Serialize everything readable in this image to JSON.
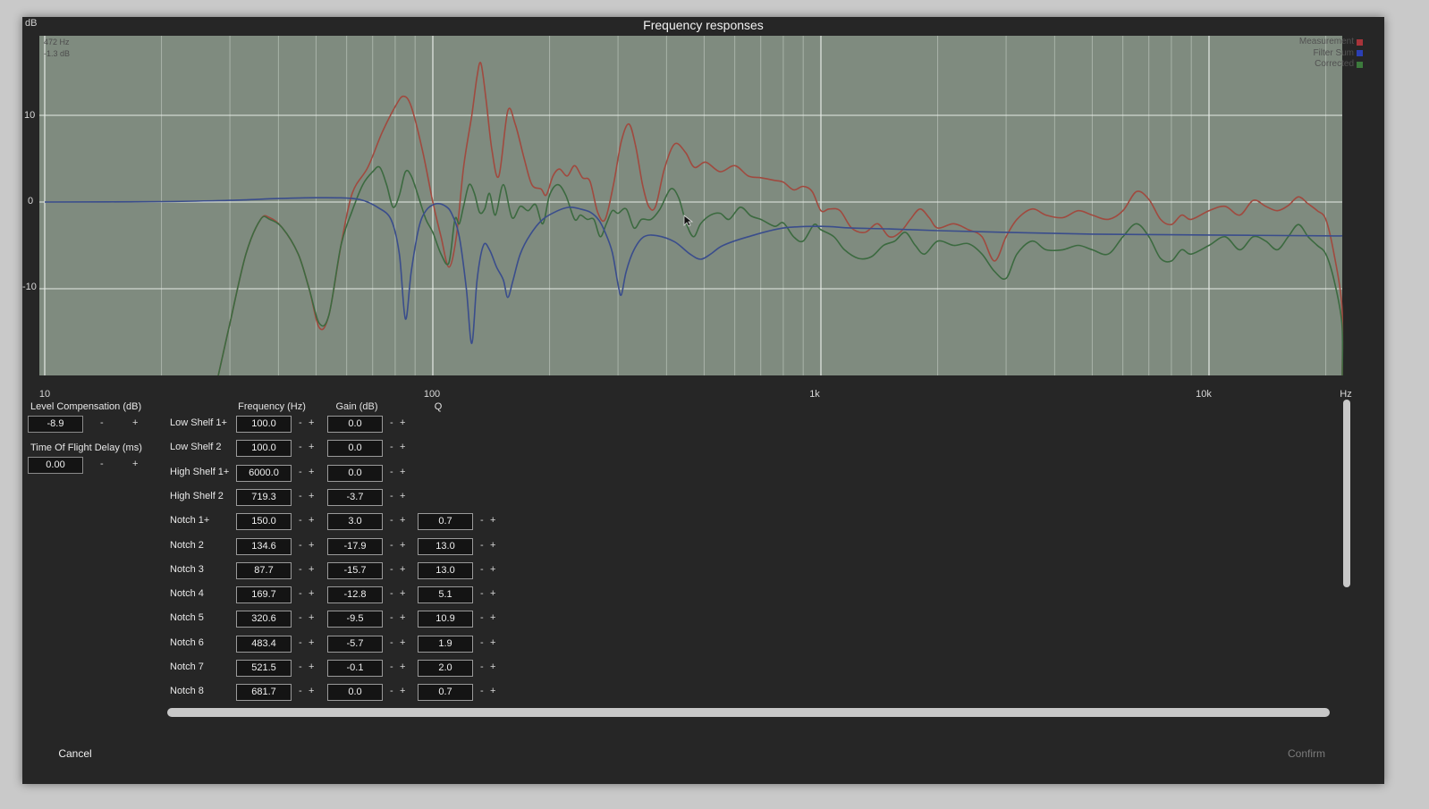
{
  "window": {
    "title": "Frequency responses"
  },
  "chart_data": {
    "type": "line",
    "ylabel": "dB",
    "xlabel": "Hz",
    "xscale": "log",
    "xlim": [
      10,
      20000
    ],
    "ylim": [
      -20,
      20
    ],
    "yticks": [
      10,
      0,
      -10
    ],
    "ytick_labels": [
      "10",
      "0",
      "-10"
    ],
    "xticks": [
      10,
      100,
      1000,
      10000
    ],
    "xtick_labels": [
      "10",
      "100",
      "1k",
      "10k"
    ],
    "grid": true,
    "legend_position": "top-right",
    "cursor_readout": {
      "freq": "472 Hz",
      "level": "-1.3 dB"
    },
    "series": [
      {
        "name": "Measurement",
        "color": "#a04a3f",
        "points": [
          [
            28,
            -20
          ],
          [
            30,
            -14
          ],
          [
            33,
            -6
          ],
          [
            36,
            -2
          ],
          [
            38,
            -1.8
          ],
          [
            41,
            -3
          ],
          [
            45,
            -6
          ],
          [
            48,
            -10
          ],
          [
            51,
            -14.5
          ],
          [
            54,
            -13
          ],
          [
            58,
            -5
          ],
          [
            62,
            1
          ],
          [
            68,
            4
          ],
          [
            74,
            8
          ],
          [
            80,
            11
          ],
          [
            84,
            12.2
          ],
          [
            88,
            11
          ],
          [
            94,
            6
          ],
          [
            100,
            0
          ],
          [
            105,
            -4
          ],
          [
            110,
            -7.5
          ],
          [
            115,
            -4
          ],
          [
            120,
            4
          ],
          [
            126,
            10
          ],
          [
            130,
            14.5
          ],
          [
            133,
            16
          ],
          [
            137,
            12
          ],
          [
            142,
            6
          ],
          [
            148,
            3
          ],
          [
            156,
            10.5
          ],
          [
            163,
            9
          ],
          [
            172,
            5
          ],
          [
            180,
            2
          ],
          [
            190,
            1.5
          ],
          [
            196,
            0.8
          ],
          [
            204,
            3
          ],
          [
            212,
            3.8
          ],
          [
            222,
            3
          ],
          [
            232,
            4.2
          ],
          [
            243,
            2.8
          ],
          [
            254,
            2.4
          ],
          [
            266,
            -1.2
          ],
          [
            278,
            -2
          ],
          [
            292,
            2
          ],
          [
            306,
            7
          ],
          [
            320,
            9
          ],
          [
            333,
            6.5
          ],
          [
            347,
            2
          ],
          [
            360,
            -0.5
          ],
          [
            375,
            -0.5
          ],
          [
            395,
            3.8
          ],
          [
            420,
            6.7
          ],
          [
            448,
            5.7
          ],
          [
            472,
            4
          ],
          [
            505,
            4.6
          ],
          [
            550,
            3.5
          ],
          [
            600,
            4.2
          ],
          [
            650,
            3
          ],
          [
            700,
            2.8
          ],
          [
            760,
            2.5
          ],
          [
            800,
            2.3
          ],
          [
            850,
            1.4
          ],
          [
            900,
            1.8
          ],
          [
            950,
            1.2
          ],
          [
            1000,
            -1
          ],
          [
            1050,
            -0.8
          ],
          [
            1120,
            -1
          ],
          [
            1200,
            -3
          ],
          [
            1300,
            -3.5
          ],
          [
            1400,
            -2.5
          ],
          [
            1500,
            -4
          ],
          [
            1600,
            -3.5
          ],
          [
            1700,
            -2
          ],
          [
            1800,
            -0.8
          ],
          [
            1900,
            -1.8
          ],
          [
            2000,
            -3
          ],
          [
            2200,
            -2.5
          ],
          [
            2400,
            -3.2
          ],
          [
            2600,
            -4
          ],
          [
            2800,
            -6.8
          ],
          [
            3000,
            -4
          ],
          [
            3200,
            -2
          ],
          [
            3500,
            -0.8
          ],
          [
            3800,
            -1.5
          ],
          [
            4200,
            -1.8
          ],
          [
            4600,
            -1
          ],
          [
            5000,
            -1.5
          ],
          [
            5500,
            -2
          ],
          [
            6000,
            -1
          ],
          [
            6500,
            1.2
          ],
          [
            7000,
            0.3
          ],
          [
            7500,
            -2
          ],
          [
            8000,
            -2.6
          ],
          [
            8500,
            -1.5
          ],
          [
            9000,
            -2
          ],
          [
            10000,
            -1
          ],
          [
            11000,
            -0.5
          ],
          [
            12000,
            -1.5
          ],
          [
            13000,
            0.2
          ],
          [
            14000,
            -0.5
          ],
          [
            15000,
            -1
          ],
          [
            16000,
            -0.4
          ],
          [
            17000,
            0.6
          ],
          [
            18000,
            -0.2
          ],
          [
            19000,
            -1
          ],
          [
            20000,
            -2
          ],
          [
            21000,
            -6
          ],
          [
            22000,
            -12
          ],
          [
            23000,
            -20
          ]
        ]
      },
      {
        "name": "Filter Sum",
        "color": "#3a4d8c",
        "points": [
          [
            10,
            0
          ],
          [
            20,
            0.05
          ],
          [
            30,
            0.2
          ],
          [
            40,
            0.4
          ],
          [
            50,
            0.5
          ],
          [
            60,
            0.45
          ],
          [
            66,
            0.2
          ],
          [
            72,
            -0.6
          ],
          [
            78,
            -2
          ],
          [
            82,
            -6
          ],
          [
            85,
            -13.5
          ],
          [
            88,
            -8
          ],
          [
            92,
            -3
          ],
          [
            96,
            -1
          ],
          [
            102,
            -0.2
          ],
          [
            108,
            -0.5
          ],
          [
            112,
            -1.4
          ],
          [
            117,
            -4
          ],
          [
            122,
            -10
          ],
          [
            126,
            -16.3
          ],
          [
            130,
            -9
          ],
          [
            135,
            -5
          ],
          [
            140,
            -5.5
          ],
          [
            146,
            -7.5
          ],
          [
            152,
            -9
          ],
          [
            156,
            -11
          ],
          [
            161,
            -9
          ],
          [
            168,
            -6
          ],
          [
            178,
            -3.8
          ],
          [
            192,
            -2
          ],
          [
            210,
            -1
          ],
          [
            225,
            -0.6
          ],
          [
            240,
            -0.8
          ],
          [
            255,
            -1.2
          ],
          [
            268,
            -2.1
          ],
          [
            278,
            -3.5
          ],
          [
            290,
            -5.8
          ],
          [
            300,
            -9.5
          ],
          [
            306,
            -10.7
          ],
          [
            315,
            -8
          ],
          [
            330,
            -5.5
          ],
          [
            350,
            -4
          ],
          [
            380,
            -3.9
          ],
          [
            420,
            -4.6
          ],
          [
            460,
            -6
          ],
          [
            490,
            -6.6
          ],
          [
            520,
            -6
          ],
          [
            560,
            -5
          ],
          [
            650,
            -4
          ],
          [
            800,
            -3
          ],
          [
            1000,
            -2.8
          ],
          [
            1200,
            -3
          ],
          [
            1500,
            -3.1
          ],
          [
            2000,
            -3.3
          ],
          [
            3000,
            -3.5
          ],
          [
            5000,
            -3.7
          ],
          [
            10000,
            -3.8
          ],
          [
            20000,
            -3.9
          ],
          [
            23000,
            -3.9
          ]
        ]
      },
      {
        "name": "Corrected",
        "color": "#3c6a40",
        "points": [
          [
            28,
            -20
          ],
          [
            30,
            -14
          ],
          [
            33,
            -6
          ],
          [
            36,
            -2
          ],
          [
            38,
            -2
          ],
          [
            41,
            -3
          ],
          [
            45,
            -6
          ],
          [
            48,
            -10
          ],
          [
            51,
            -14
          ],
          [
            54,
            -13
          ],
          [
            58,
            -5
          ],
          [
            62,
            -1
          ],
          [
            66,
            2
          ],
          [
            70,
            3.5
          ],
          [
            73,
            4
          ],
          [
            76,
            2
          ],
          [
            79,
            -0.6
          ],
          [
            82,
            0.8
          ],
          [
            85,
            3.5
          ],
          [
            88,
            3
          ],
          [
            92,
            0.5
          ],
          [
            96,
            -2
          ],
          [
            100,
            -3.5
          ],
          [
            105,
            -6
          ],
          [
            110,
            -7
          ],
          [
            114,
            -2
          ],
          [
            117,
            -2.5
          ],
          [
            120,
            -0.5
          ],
          [
            124,
            2
          ],
          [
            128,
            1
          ],
          [
            132,
            -1.2
          ],
          [
            136,
            -0.8
          ],
          [
            140,
            1
          ],
          [
            145,
            -1.5
          ],
          [
            152,
            2
          ],
          [
            160,
            -1.8
          ],
          [
            168,
            -0.5
          ],
          [
            176,
            -1
          ],
          [
            184,
            -0.3
          ],
          [
            192,
            -2.5
          ],
          [
            200,
            0.8
          ],
          [
            210,
            2
          ],
          [
            220,
            0.8
          ],
          [
            232,
            -2
          ],
          [
            240,
            -1.5
          ],
          [
            250,
            -2
          ],
          [
            260,
            -2
          ],
          [
            270,
            -4
          ],
          [
            280,
            -2.5
          ],
          [
            290,
            -1
          ],
          [
            300,
            -1.3
          ],
          [
            315,
            -0.8
          ],
          [
            330,
            -3
          ],
          [
            345,
            -2
          ],
          [
            365,
            -2
          ],
          [
            385,
            -0.8
          ],
          [
            410,
            1.5
          ],
          [
            430,
            0.5
          ],
          [
            450,
            -2.5
          ],
          [
            470,
            -4
          ],
          [
            490,
            -2.5
          ],
          [
            520,
            -1.5
          ],
          [
            550,
            -1.3
          ],
          [
            580,
            -2
          ],
          [
            620,
            -0.6
          ],
          [
            660,
            -1.6
          ],
          [
            700,
            -2
          ],
          [
            760,
            -2.8
          ],
          [
            800,
            -2.4
          ],
          [
            850,
            -4
          ],
          [
            900,
            -4.5
          ],
          [
            960,
            -2.6
          ],
          [
            1000,
            -3.2
          ],
          [
            1080,
            -4
          ],
          [
            1150,
            -5.5
          ],
          [
            1250,
            -6.5
          ],
          [
            1350,
            -6.3
          ],
          [
            1450,
            -5
          ],
          [
            1550,
            -4.5
          ],
          [
            1650,
            -3.5
          ],
          [
            1750,
            -5
          ],
          [
            1850,
            -6
          ],
          [
            2000,
            -4.5
          ],
          [
            2200,
            -5
          ],
          [
            2400,
            -4.8
          ],
          [
            2600,
            -6
          ],
          [
            2800,
            -8
          ],
          [
            3000,
            -8.8
          ],
          [
            3200,
            -6
          ],
          [
            3500,
            -4.5
          ],
          [
            3800,
            -5.5
          ],
          [
            4200,
            -5.5
          ],
          [
            4600,
            -5
          ],
          [
            5000,
            -5.5
          ],
          [
            5500,
            -6
          ],
          [
            6000,
            -4
          ],
          [
            6500,
            -2.5
          ],
          [
            7000,
            -4
          ],
          [
            7500,
            -6.5
          ],
          [
            8000,
            -6.8
          ],
          [
            8500,
            -5.5
          ],
          [
            9000,
            -6
          ],
          [
            10000,
            -5
          ],
          [
            11000,
            -4
          ],
          [
            12000,
            -5.5
          ],
          [
            13000,
            -4
          ],
          [
            14000,
            -4.5
          ],
          [
            15000,
            -5.5
          ],
          [
            16000,
            -4
          ],
          [
            17000,
            -2.6
          ],
          [
            18000,
            -4
          ],
          [
            19000,
            -5
          ],
          [
            20000,
            -6
          ],
          [
            21000,
            -9
          ],
          [
            22000,
            -14
          ],
          [
            23000,
            -20
          ]
        ]
      }
    ]
  },
  "left_panel": {
    "level_comp_label": "Level Compensation (dB)",
    "level_comp_value": "-8.9",
    "tof_label": "Time Of Flight Delay (ms)",
    "tof_value": "0.00",
    "minus": "-",
    "plus": "+"
  },
  "filters": {
    "columns": {
      "frequency": "Frequency (Hz)",
      "gain": "Gain (dB)",
      "q": "Q"
    },
    "rows": [
      {
        "label": "Low Shelf 1+",
        "freq": "100.0",
        "gain": "0.0",
        "q": null
      },
      {
        "label": "Low Shelf 2",
        "freq": "100.0",
        "gain": "0.0",
        "q": null
      },
      {
        "label": "High Shelf 1+",
        "freq": "6000.0",
        "gain": "0.0",
        "q": null
      },
      {
        "label": "High Shelf 2",
        "freq": "719.3",
        "gain": "-3.7",
        "q": null
      },
      {
        "label": "Notch 1+",
        "freq": "150.0",
        "gain": "3.0",
        "q": "0.7"
      },
      {
        "label": "Notch 2",
        "freq": "134.6",
        "gain": "-17.9",
        "q": "13.0"
      },
      {
        "label": "Notch 3",
        "freq": "87.7",
        "gain": "-15.7",
        "q": "13.0"
      },
      {
        "label": "Notch 4",
        "freq": "169.7",
        "gain": "-12.8",
        "q": "5.1"
      },
      {
        "label": "Notch 5",
        "freq": "320.6",
        "gain": "-9.5",
        "q": "10.9"
      },
      {
        "label": "Notch 6",
        "freq": "483.4",
        "gain": "-5.7",
        "q": "1.9"
      },
      {
        "label": "Notch 7",
        "freq": "521.5",
        "gain": "-0.1",
        "q": "2.0"
      },
      {
        "label": "Notch 8",
        "freq": "681.7",
        "gain": "0.0",
        "q": "0.7"
      }
    ]
  },
  "footer": {
    "cancel": "Cancel",
    "confirm": "Confirm"
  }
}
